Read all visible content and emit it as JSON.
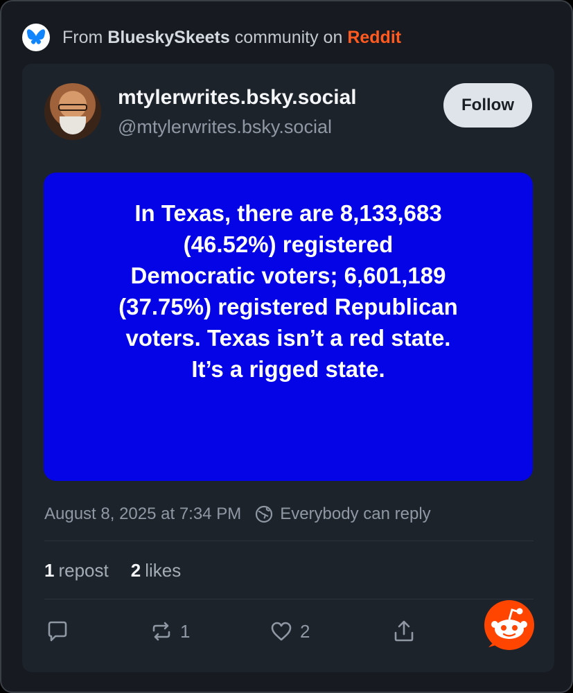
{
  "source": {
    "prefix": "From",
    "community": "BlueskySkeets",
    "middle": "community on",
    "platform": "Reddit"
  },
  "post": {
    "author_name": "mtylerwrites.bsky.social",
    "author_handle": "@mtylerwrites.bsky.social",
    "follow_label": "Follow",
    "image_text": "In Texas, there are 8,133,683\n(46.52%) registered\nDemocratic voters; 6,601,189\n(37.75%) registered Republican\nvoters. Texas isn’t a red state.\nIt’s a rigged state.",
    "timestamp": "August 8, 2025 at 7:34 PM",
    "reply_setting": "Everybody can reply",
    "stats": {
      "repost_count": "1",
      "repost_label": "repost",
      "like_count": "2",
      "like_label": "likes"
    },
    "actions": {
      "reply_count": "",
      "repost_count": "1",
      "like_count": "2"
    }
  },
  "colors": {
    "background": "#171b21",
    "card": "#1d232b",
    "image_blue": "#0404e6",
    "reddit_orange": "#ff4500",
    "bluesky_blue": "#1185fe"
  },
  "icons": [
    "bluesky-logo-icon",
    "globe-icon",
    "reply-icon",
    "repost-icon",
    "heart-icon",
    "share-icon",
    "reddit-snoo-icon"
  ]
}
